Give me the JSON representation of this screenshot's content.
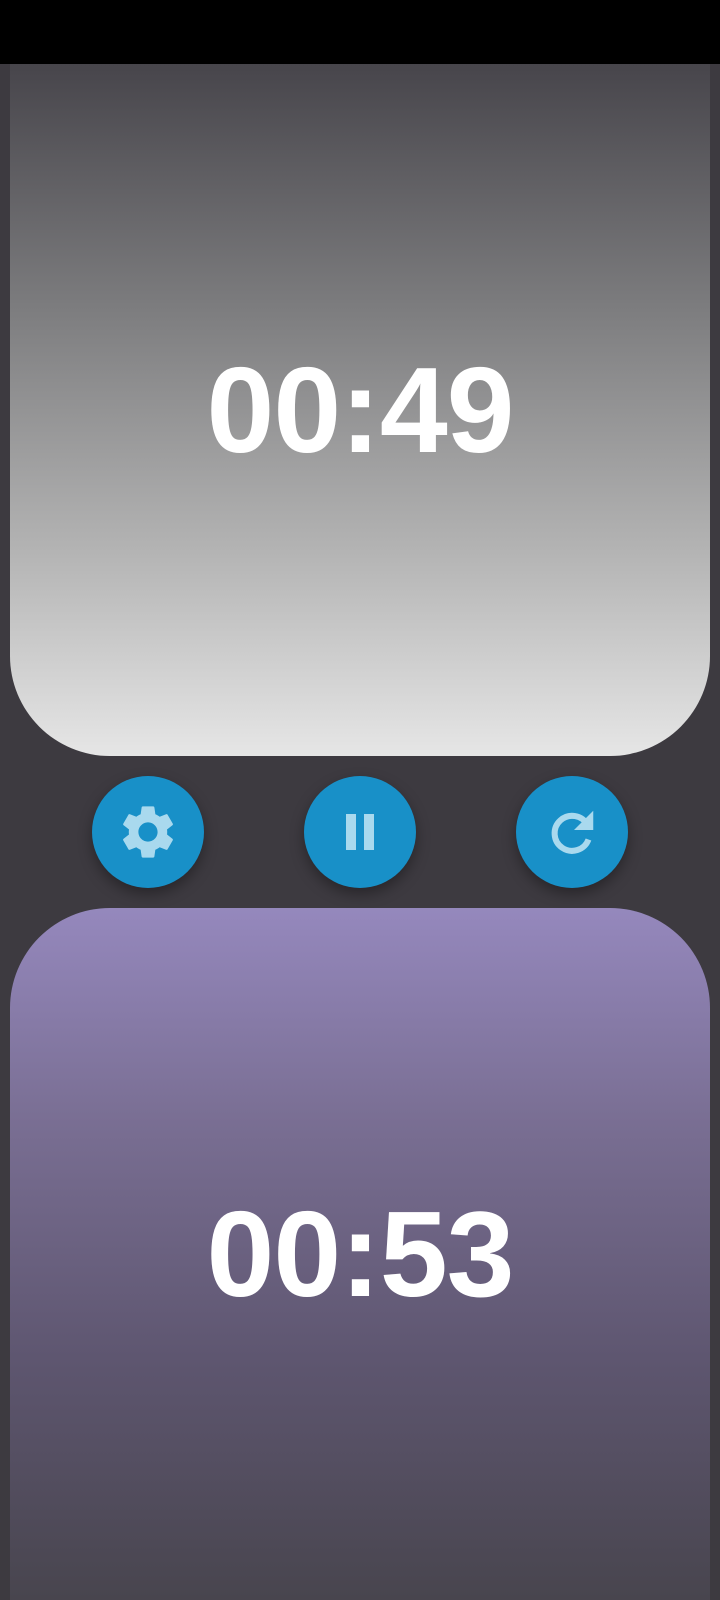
{
  "colors": {
    "status_bar": "#000000",
    "background": "#3d3a40",
    "top_panel_gradient": [
      "#47454b",
      "#e6e6e6"
    ],
    "bottom_panel_gradient": [
      "#9588bd",
      "#48454e"
    ],
    "button": "#1890c8",
    "icon": "#a9d9ee",
    "time_text": "#ffffff"
  },
  "player_top": {
    "time": "00:49"
  },
  "player_bottom": {
    "time": "00:53"
  },
  "controls": {
    "settings_icon": "gear-icon",
    "pause_icon": "pause-icon",
    "reset_icon": "reset-icon"
  }
}
